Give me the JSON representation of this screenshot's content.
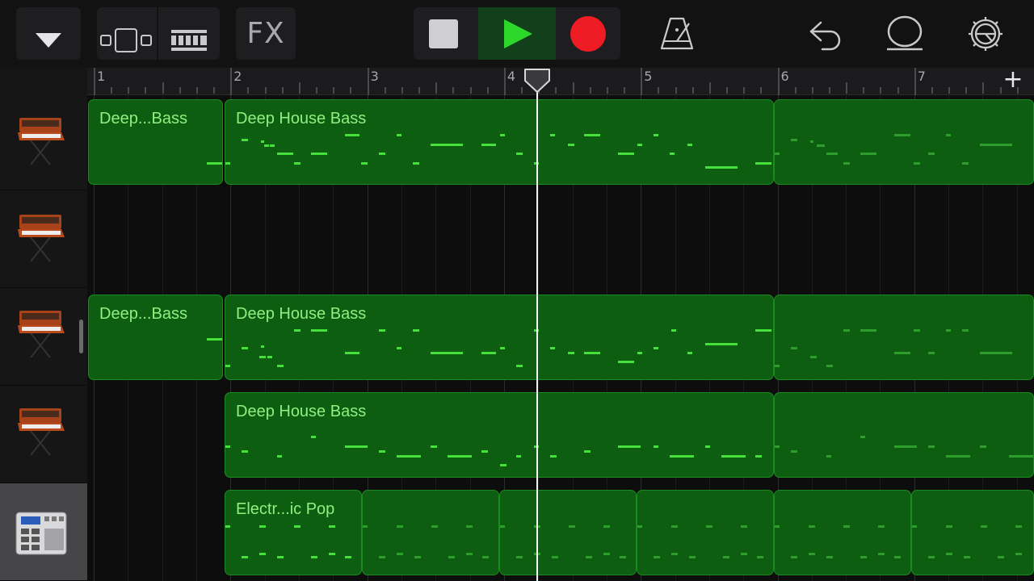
{
  "toolbar": {
    "fx_label": "FX",
    "icons": [
      "track-menu-chevron-icon",
      "tracks-view-icon",
      "grid-view-icon",
      "stop-icon",
      "play-icon",
      "record-icon",
      "metronome-icon",
      "undo-icon",
      "loop-icon",
      "settings-icon"
    ]
  },
  "ruler": {
    "bars": [
      "1",
      "2",
      "3",
      "4",
      "5",
      "6",
      "7"
    ],
    "add_label": "+"
  },
  "tracks": [
    {
      "instrument": "synth-keyboard-icon",
      "regions": [
        {
          "name": "Deep...Bass"
        },
        {
          "name": "Deep House Bass"
        }
      ]
    },
    {
      "instrument": "synth-keyboard-icon",
      "regions": []
    },
    {
      "instrument": "synth-keyboard-icon",
      "regions": [
        {
          "name": "Deep...Bass"
        },
        {
          "name": "Deep House Bass"
        }
      ]
    },
    {
      "instrument": "synth-keyboard-icon",
      "regions": [
        {
          "name": "Deep House Bass"
        }
      ]
    },
    {
      "instrument": "drum-machine-icon",
      "selected": true,
      "regions": [
        {
          "name": "Electr...ic Pop"
        }
      ]
    }
  ],
  "colors": {
    "region_fill": "#0e5e12",
    "region_text": "#8ef07f",
    "note": "#46e03a",
    "play_active": "#2ed82b",
    "record": "#ee1c24"
  }
}
